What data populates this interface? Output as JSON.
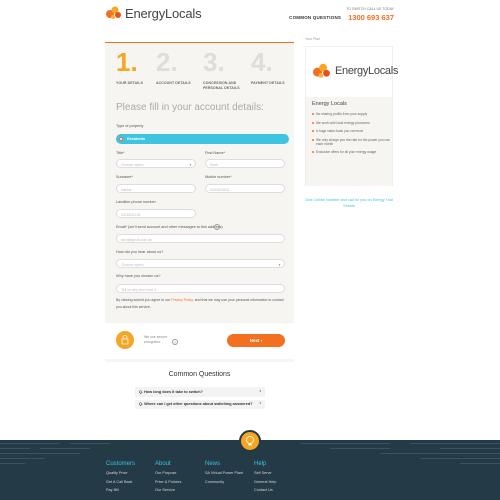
{
  "header": {
    "logo_text": "EnergyLocals",
    "phone_caption": "TO SWITCH CALL US TODAY",
    "common_questions_link": "COMMON QUESTIONS",
    "phone": "1300 693 637"
  },
  "steps": [
    {
      "num": "1.",
      "label": "YOUR DETAILS",
      "active": true
    },
    {
      "num": "2.",
      "label": "ACCOUNT DETAILS",
      "active": false
    },
    {
      "num": "3.",
      "label": "CONCESSION AND PERSONAL DETAILS",
      "active": false
    },
    {
      "num": "4.",
      "label": "PAYMENT DETAILS",
      "active": false
    }
  ],
  "form": {
    "heading": "Please fill in your account details:",
    "property_label": "Type of property",
    "property_value": "Residents",
    "title_label": "Title*",
    "title_placeholder": "Choose option",
    "first_name_label": "First Name*",
    "first_name_placeholder": "Rach",
    "surname_label": "Surname*",
    "surname_placeholder": "Harber",
    "mobile_label": "Mobile number*",
    "mobile_placeholder": "0434523501",
    "landline_label": "Landline phone number",
    "landline_placeholder": "0416531234",
    "email_label": "Email* (we'll send account and other messages to this address)",
    "email_placeholder": "rach@gmail.com.au",
    "hear_label": "How did you hear about us?",
    "hear_placeholder": "Choose option",
    "why_label": "Why have you chosen us?",
    "why_placeholder": "Tell us why don't feel it...",
    "consent_pre": "By clicking submit you agree to our ",
    "consent_link": "Privacy Policy",
    "consent_post": ", and that we may use your personal information to contact you about this service.",
    "secure_text": "We use secure encryption.",
    "next_label": "Next ›"
  },
  "sidebar": {
    "breadcrumb": "Your Plan",
    "logo_text": "EnergyLocals",
    "title": "Energy Locals",
    "benefits": [
      "No sharing profits from your supply",
      "We work with local energy producers",
      "A huge value-back you can trust",
      "We only charge you the rate for the power you use each month",
      "Exclusive offers for all your energy usage"
    ],
    "help_text": "Give Online Number and call for you on Energy Trial Sheets"
  },
  "common_questions": {
    "title": "Common Questions",
    "items": [
      "Q. How long does it take to switch?",
      "Q. Where can I get other questions about switching answered?"
    ]
  },
  "footer": {
    "columns": [
      {
        "title": "Customers",
        "links": [
          "Quality Price",
          "Get A Call Back",
          "Pay Bill"
        ]
      },
      {
        "title": "About",
        "links": [
          "Our Purpose",
          "Price & Policies",
          "Our Service"
        ]
      },
      {
        "title": "News",
        "links": [
          "SA Virtual Power Plant",
          "Community"
        ]
      },
      {
        "title": "Help",
        "links": [
          "Self Serve",
          "General Help",
          "Contact Us"
        ]
      }
    ]
  },
  "colors": {
    "orange": "#f37021",
    "yellow": "#f5a623",
    "cyan": "#3ec3e0",
    "footer_bg": "#243a47"
  }
}
